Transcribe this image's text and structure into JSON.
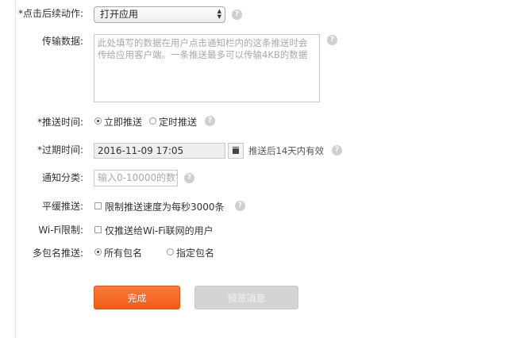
{
  "form": {
    "click_action": {
      "label": "*点击后续动作:",
      "selected": "打开应用",
      "arrow_up": "▲",
      "arrow_down": "▼",
      "help": "?"
    },
    "payload": {
      "label": "传输数据:",
      "placeholder": "此处填写的数据在用户点击通知栏内的这条推送时会传给应用客户端。一条推送最多可以传输4KB的数据",
      "help": "?"
    },
    "send_time": {
      "label": "*推送时间:",
      "options": [
        {
          "text": "立即推送",
          "checked": true
        },
        {
          "text": "定时推送",
          "checked": false
        }
      ],
      "help": "?"
    },
    "expire_time": {
      "label": "*过期时间:",
      "value": "2016-11-09 17:05",
      "hint": "推送后14天内有效",
      "help": "?"
    },
    "category": {
      "label": "通知分类:",
      "placeholder": "输入0-10000的数字",
      "help": "?"
    },
    "throttle": {
      "label": "平缓推送:",
      "option": "限制推送速度为每秒3000条",
      "checked": false,
      "help": "?"
    },
    "wifi": {
      "label": "Wi-Fi限制:",
      "option": "仅推送给Wi-Fi联网的用户",
      "checked": false
    },
    "packages": {
      "label": "多包名推送:",
      "options": [
        {
          "text": "所有包名",
          "checked": true
        },
        {
          "text": "指定包名",
          "checked": false
        }
      ]
    }
  },
  "actions": {
    "submit_label": "完成",
    "preview_label": "预览消息"
  },
  "colors": {
    "primary": "#f26522",
    "disabled": "#d4d4d4",
    "help_icon": "#cfcfcf"
  }
}
